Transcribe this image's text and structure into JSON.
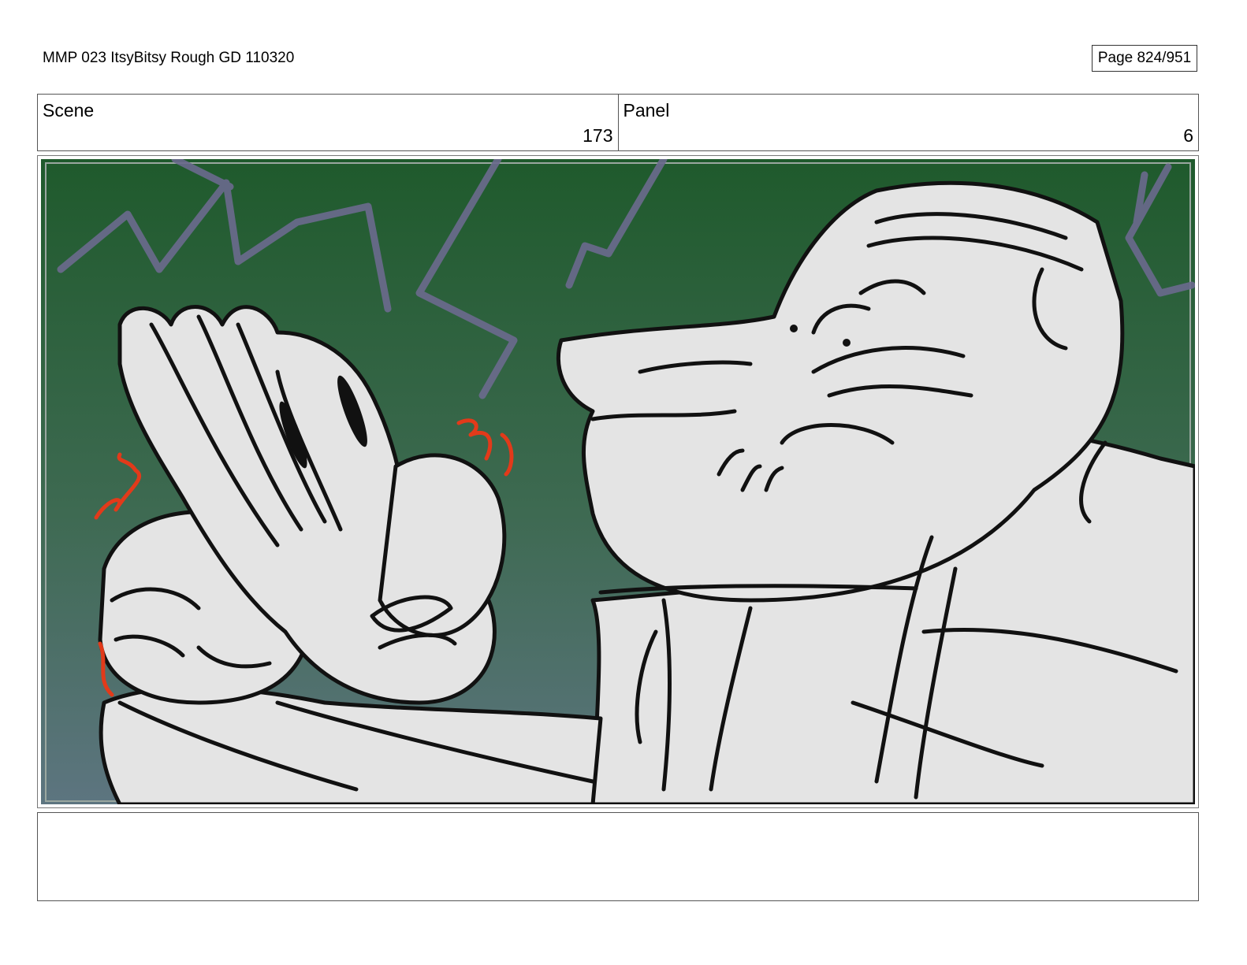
{
  "header": {
    "title": "MMP 023 ItsyBitsy Rough GD 110320",
    "page": "Page 824/951"
  },
  "scene": {
    "label": "Scene",
    "value": "173"
  },
  "panel": {
    "label": "Panel",
    "value": "6"
  },
  "notes": {
    "text": ""
  },
  "colors": {
    "bg_top": "#1f5a2c",
    "bg_bottom": "#5d7580",
    "lightning": "#6b6a8e",
    "figure_fill": "#e4e4e4",
    "ink": "#111111",
    "shake_marks": "#e23a1a"
  }
}
